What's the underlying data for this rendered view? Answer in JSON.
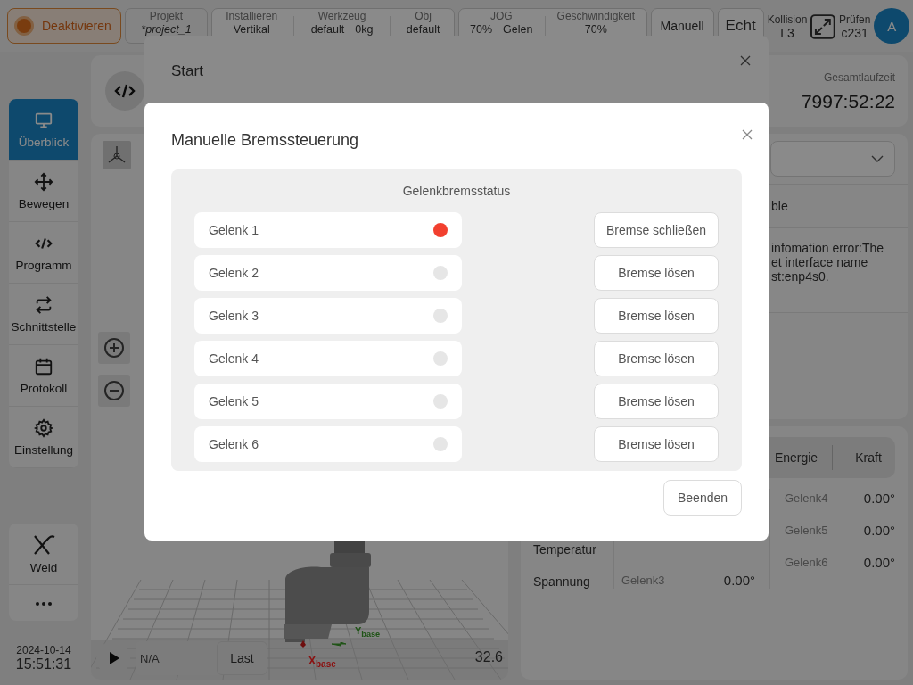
{
  "top_bar": {
    "power_button": "Deaktivieren",
    "groups": [
      [
        {
          "label": "Projekt",
          "values": [
            "*project_1"
          ]
        }
      ],
      [
        {
          "label": "Installieren",
          "values": [
            "Vertikal"
          ]
        },
        {
          "label": "Werkzeug",
          "values": [
            "default",
            "0kg"
          ]
        },
        {
          "label": "Obj",
          "values": [
            "default"
          ]
        }
      ],
      [
        {
          "label": "JOG",
          "values": [
            "70%",
            "Gelen"
          ]
        },
        {
          "label": "Geschwindigkeit",
          "values": [
            "70%"
          ]
        }
      ]
    ],
    "mode_buttons": [
      "Manuell",
      "Echt"
    ],
    "collision": {
      "label": "Kollision",
      "value": "L3"
    },
    "check": {
      "label": "Prüfen",
      "value": "c231"
    },
    "avatar": "A"
  },
  "sidebar": {
    "items": [
      {
        "label": "Überblick",
        "kind": "monitor",
        "selected": true
      },
      {
        "label": "Bewegen",
        "kind": "move",
        "selected": false
      },
      {
        "label": "Programm",
        "kind": "code",
        "selected": false
      },
      {
        "label": "Schnittstelle",
        "kind": "swap",
        "selected": false
      },
      {
        "label": "Protokoll",
        "kind": "calendar",
        "selected": false
      },
      {
        "label": "Einstellung",
        "kind": "gear",
        "selected": false
      }
    ],
    "tool": "Weld",
    "date": "2024-10-14",
    "time": "15:51:31"
  },
  "viewport": {
    "axes": [
      "X$_{base}$",
      "Y$_{base}$"
    ],
    "player": {
      "value": "N/A",
      "button": "Last"
    },
    "reading": "32.6"
  },
  "right": {
    "runtime": {
      "label": "Gesamtlaufzeit",
      "value": "7997:52:22"
    },
    "status_text": "ble",
    "error_lines": [
      "infomation error:The",
      "et interface name",
      "st:enp4s0."
    ],
    "tabs": [
      "Energie",
      "Kraft"
    ],
    "row_labels": [
      "Temperatur",
      "Spannung"
    ],
    "middle_joints": [
      {
        "name": "Gelenk3",
        "value": "0.00°"
      }
    ],
    "right_joints": [
      {
        "name": "Gelenk4",
        "value": "0.00°"
      },
      {
        "name": "Gelenk5",
        "value": "0.00°"
      },
      {
        "name": "Gelenk6",
        "value": "0.00°"
      }
    ]
  },
  "start_dialog": {
    "title": "Start"
  },
  "brake_dialog": {
    "title": "Manuelle Bremssteuerung",
    "section_title": "Gelenkbremsstatus",
    "joints": [
      {
        "name": "Gelenk 1",
        "released": true,
        "action": "Bremse schließen"
      },
      {
        "name": "Gelenk 2",
        "released": false,
        "action": "Bremse lösen"
      },
      {
        "name": "Gelenk 3",
        "released": false,
        "action": "Bremse lösen"
      },
      {
        "name": "Gelenk 4",
        "released": false,
        "action": "Bremse lösen"
      },
      {
        "name": "Gelenk 5",
        "released": false,
        "action": "Bremse lösen"
      },
      {
        "name": "Gelenk 6",
        "released": false,
        "action": "Bremse lösen"
      }
    ],
    "finish_button": "Beenden"
  }
}
